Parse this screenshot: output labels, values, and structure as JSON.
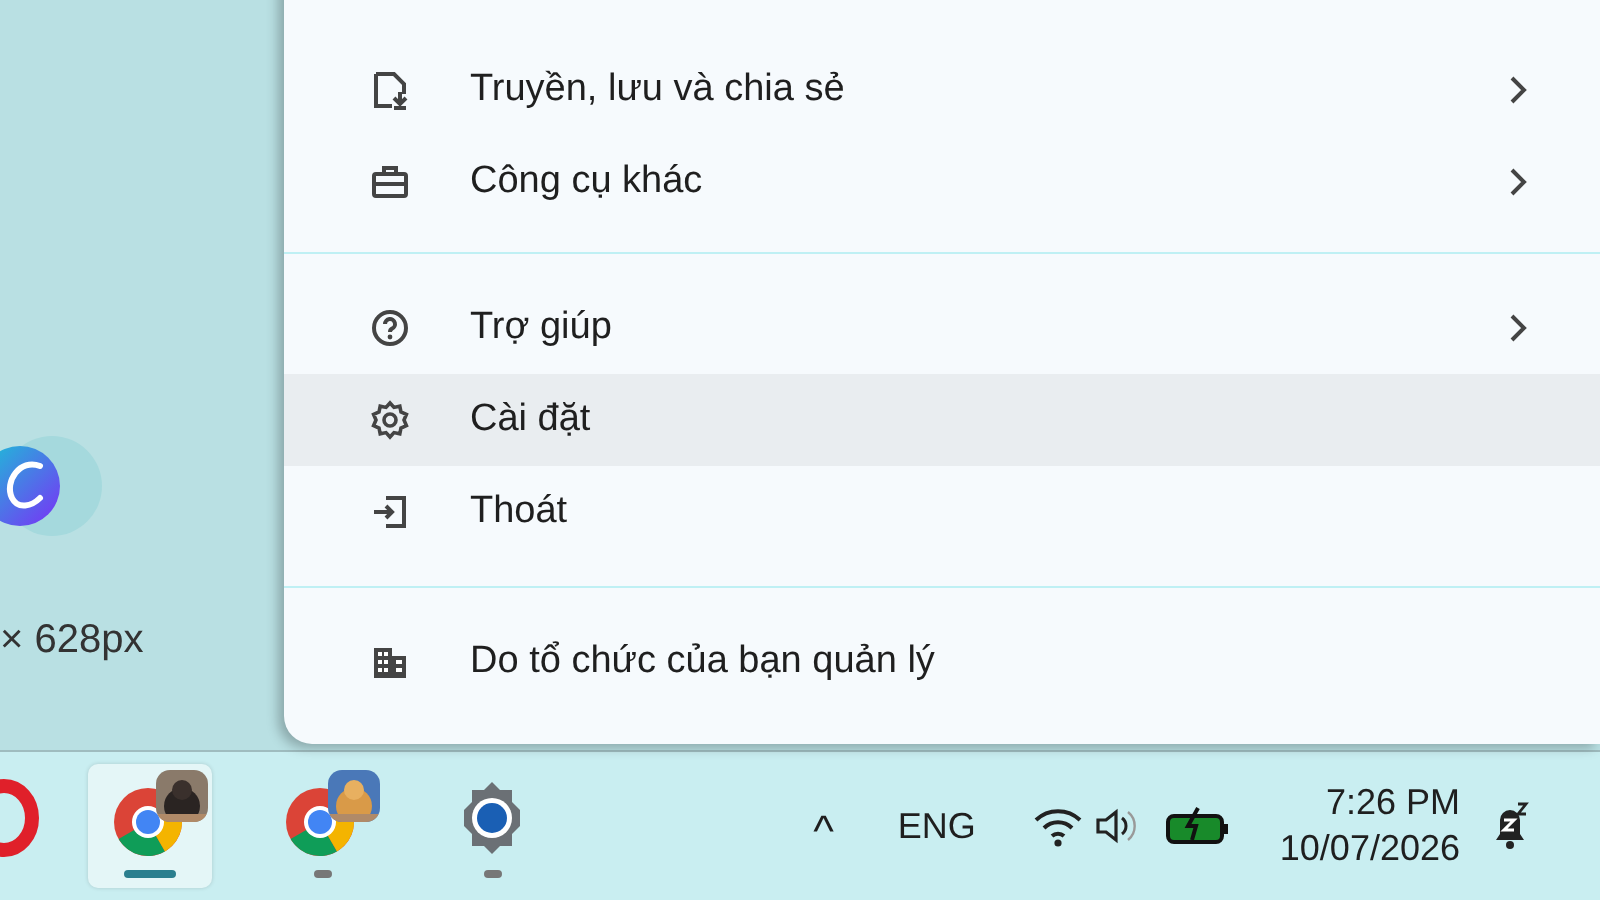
{
  "canvas": {
    "caption": "× 628px"
  },
  "menu": {
    "groups": [
      {
        "items": [
          {
            "label": "Truyền, lưu và chia sẻ",
            "submenu": true,
            "selected": false
          },
          {
            "label": "Công cụ khác",
            "submenu": true,
            "selected": false
          }
        ]
      },
      {
        "items": [
          {
            "label": "Trợ giúp",
            "submenu": true,
            "selected": false
          },
          {
            "label": "Cài đặt",
            "submenu": false,
            "selected": true
          },
          {
            "label": "Thoát",
            "submenu": false,
            "selected": false
          }
        ]
      },
      {
        "items": [
          {
            "label": "Do tổ chức của bạn quản lý",
            "submenu": false,
            "selected": false
          }
        ]
      }
    ]
  },
  "taskbar": {
    "apps": [
      {
        "kind": "opera",
        "selected": false,
        "running": false
      },
      {
        "kind": "chrome",
        "selected": true,
        "running": true
      },
      {
        "kind": "chrome",
        "selected": false,
        "running": true
      },
      {
        "kind": "settings",
        "selected": false,
        "running": true
      }
    ],
    "tray": {
      "chevron": "^",
      "language": "ENG",
      "time": "7:26 PM",
      "date": "10/07/2026"
    }
  }
}
